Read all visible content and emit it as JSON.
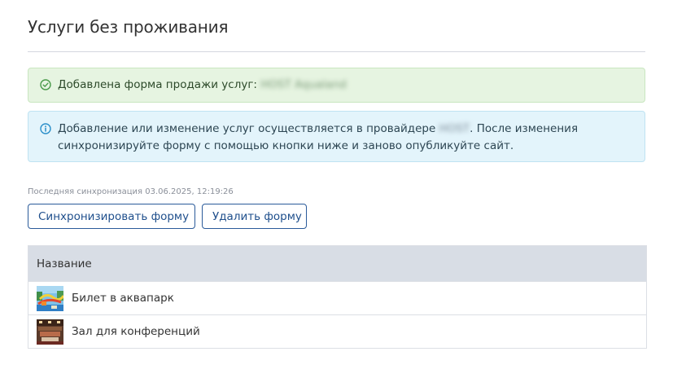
{
  "page": {
    "title": "Услуги без проживания"
  },
  "alerts": {
    "success": {
      "icon": "check-circle-icon",
      "text": "Добавлена форма продажи услуг:",
      "redacted": "HOST Aqualand"
    },
    "info": {
      "icon": "info-circle-icon",
      "line1_before": "Добавление или изменение услуг осуществляется в провайдере ",
      "redacted": "HOST",
      "line1_after": ". После изменения",
      "line2": "синхронизируйте форму с помощью кнопки ниже и заново опубликуйте сайт."
    }
  },
  "sync": {
    "last_sync": "Последняя синхронизация 03.06.2025, 12:19:26"
  },
  "buttons": {
    "sync_label": "Синхронизировать форму",
    "delete_label": "Удалить форму"
  },
  "table": {
    "header": "Название",
    "rows": [
      {
        "name": "Билет в аквапарк",
        "thumb": "waterpark-photo"
      },
      {
        "name": "Зал для конференций",
        "thumb": "conference-hall-photo"
      }
    ]
  },
  "colors": {
    "success_bg": "#e6f4e1",
    "info_bg": "#e3f4fb",
    "button_border": "#2b5b9a",
    "table_header_bg": "#d8dde5"
  }
}
